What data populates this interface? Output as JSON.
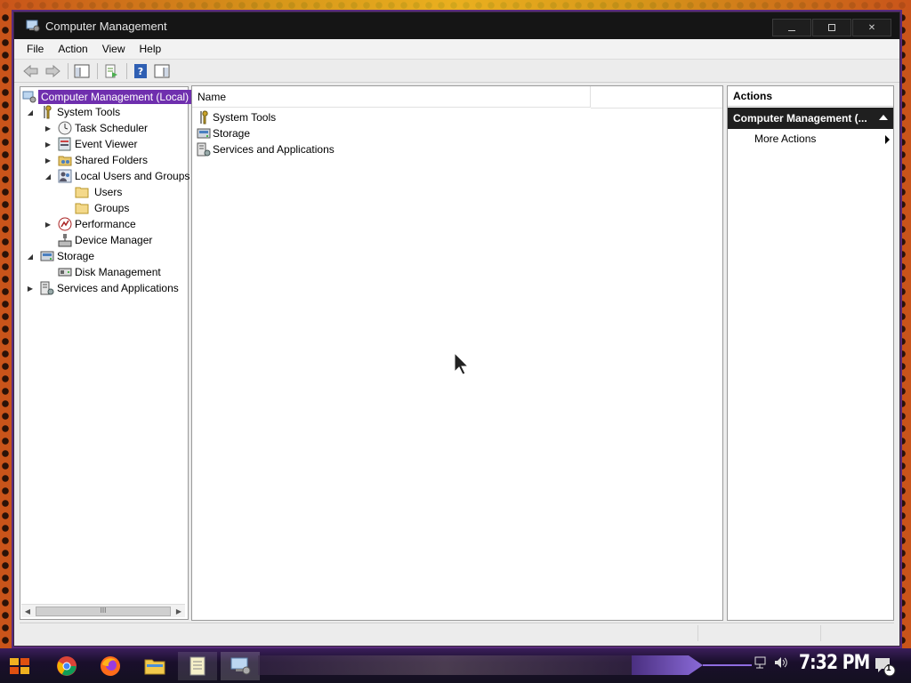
{
  "window": {
    "title": "Computer Management",
    "controls": [
      "minimize",
      "maximize",
      "close"
    ]
  },
  "menu": [
    "File",
    "Action",
    "View",
    "Help"
  ],
  "toolbar": {
    "buttons": [
      "back-icon",
      "forward-icon",
      "show-hide-console-tree-icon",
      "export-list-icon",
      "help-icon",
      "show-hide-action-pane-icon"
    ]
  },
  "tree": {
    "root": "Computer Management (Local)",
    "items": [
      {
        "label": "System Tools",
        "icon": "tools-icon",
        "expander": "expanded"
      },
      {
        "label": "Task Scheduler",
        "icon": "clock-icon",
        "expander": "collapsed"
      },
      {
        "label": "Event Viewer",
        "icon": "event-viewer-icon",
        "expander": "collapsed"
      },
      {
        "label": "Shared Folders",
        "icon": "shared-folder-icon",
        "expander": "collapsed"
      },
      {
        "label": "Local Users and Groups",
        "icon": "users-icon",
        "expander": "expanded"
      },
      {
        "label": "Users",
        "icon": "folder-icon",
        "expander": "none"
      },
      {
        "label": "Groups",
        "icon": "folder-icon",
        "expander": "none"
      },
      {
        "label": "Performance",
        "icon": "performance-icon",
        "expander": "collapsed"
      },
      {
        "label": "Device Manager",
        "icon": "device-manager-icon",
        "expander": "none"
      },
      {
        "label": "Storage",
        "icon": "storage-icon",
        "expander": "expanded"
      },
      {
        "label": "Disk Management",
        "icon": "disk-icon",
        "expander": "none"
      },
      {
        "label": "Services and Applications",
        "icon": "services-icon",
        "expander": "collapsed"
      }
    ],
    "scrollbar_thumb": "III"
  },
  "list": {
    "column_name": "Name",
    "items": [
      {
        "label": "System Tools",
        "icon": "tools-icon"
      },
      {
        "label": "Storage",
        "icon": "storage-icon"
      },
      {
        "label": "Services and Applications",
        "icon": "services-icon"
      }
    ]
  },
  "actions": {
    "header": "Actions",
    "selected": "Computer Management (...",
    "more": "More Actions"
  },
  "taskbar": {
    "apps": [
      "start-icon",
      "chrome-icon",
      "firefox-icon",
      "file-explorer-icon",
      "notepad-icon",
      "computer-management-icon"
    ],
    "tray": [
      "network-icon",
      "volume-icon"
    ],
    "clock": "7:32 PM",
    "notification_count": "1"
  },
  "colors": {
    "selection": "#6f2fae",
    "titlebar": "#151515",
    "taskbar": "#1a0f2c",
    "wallpaper": "#c9541a"
  }
}
